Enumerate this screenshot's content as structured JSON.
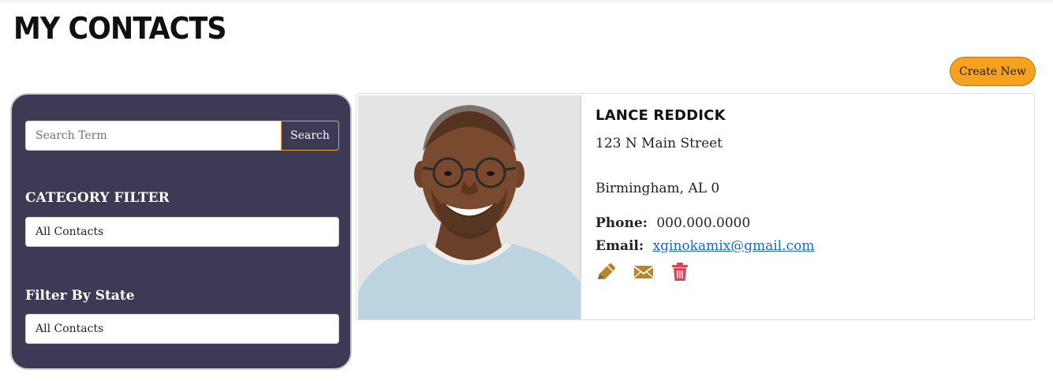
{
  "page": {
    "title": "MY CONTACTS",
    "create_label": "Create New"
  },
  "sidebar": {
    "search_placeholder": "Search Term",
    "search_label": "Search",
    "category_heading": "CATEGORY FILTER",
    "category_value": "All Contacts",
    "state_heading": "Filter By State",
    "state_value": "All Contacts"
  },
  "contact": {
    "name": "LANCE REDDICK",
    "address_line1": "123 N Main Street",
    "address_line2": "Birmingham, AL 0",
    "phone_label": "Phone:",
    "phone": "000.000.0000",
    "email_label": "Email:",
    "email": "xginokamix@gmail.com",
    "actions": [
      "edit-icon",
      "email-icon",
      "delete-icon"
    ]
  },
  "colors": {
    "accent": "#f7a21f",
    "sidebar": "#3d3a56",
    "icon_gold": "#b8862a",
    "icon_red": "#d94555",
    "link": "#1a66c9"
  }
}
